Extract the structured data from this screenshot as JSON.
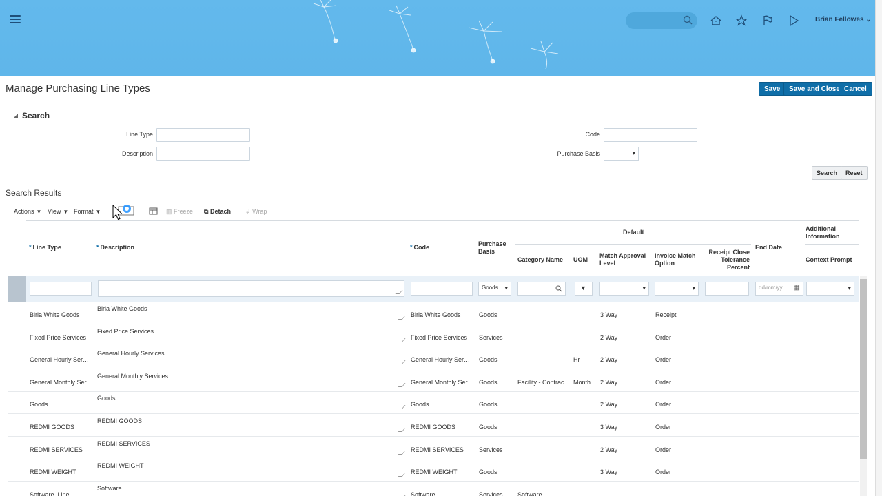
{
  "header": {
    "user_name": "Brian Fellowes",
    "icons": [
      "menu-icon",
      "search-icon",
      "home-icon",
      "star-icon",
      "flag-icon",
      "play-icon"
    ]
  },
  "page": {
    "title": "Manage Purchasing Line Types",
    "buttons": {
      "save": "Save",
      "save_close": "Save and Close",
      "cancel": "Cancel"
    }
  },
  "search": {
    "heading": "Search",
    "line_type_label": "Line Type",
    "description_label": "Description",
    "code_label": "Code",
    "purchase_basis_label": "Purchase Basis",
    "search_button": "Search",
    "reset_button": "Reset"
  },
  "results": {
    "heading": "Search Results",
    "toolbar": {
      "actions": "Actions",
      "view": "View",
      "format": "Format",
      "freeze": "Freeze",
      "detach": "Detach",
      "wrap": "Wrap"
    },
    "columns": {
      "line_type": "Line Type",
      "description": "Description",
      "code": "Code",
      "purchase_basis": "Purchase Basis",
      "default_group": "Default",
      "category_name": "Category Name",
      "uom": "UOM",
      "match_approval": "Match Approval Level",
      "invoice_match": "Invoice Match Option",
      "receipt_close": "Receipt Close Tolerance Percent",
      "end_date": "End Date",
      "additional_info": "Additional Information",
      "context_prompt": "Context Prompt"
    },
    "filters": {
      "purchase_basis": "Goods",
      "end_date_placeholder": "dd/mm/yy"
    },
    "rows": [
      {
        "line_type": "Birla White Goods",
        "description": "Birla White Goods",
        "code": "Birla White Goods",
        "basis": "Goods",
        "category": "",
        "uom": "",
        "match": "3 Way",
        "invoice": "Receipt"
      },
      {
        "line_type": "Fixed Price Services",
        "description": "Fixed Price Services",
        "code": "Fixed Price Services",
        "basis": "Services",
        "category": "",
        "uom": "",
        "match": "2 Way",
        "invoice": "Order"
      },
      {
        "line_type": "General Hourly Servi...",
        "description": "General Hourly Services",
        "code": "General Hourly Servi...",
        "basis": "Goods",
        "category": "",
        "uom": "Hr",
        "match": "2 Way",
        "invoice": "Order"
      },
      {
        "line_type": "General Monthly Ser...",
        "description": "General Monthly Services",
        "code": "General Monthly Ser...",
        "basis": "Goods",
        "category": "Facility - Contractor",
        "uom": "Month",
        "match": "2 Way",
        "invoice": "Order"
      },
      {
        "line_type": "Goods",
        "description": "Goods",
        "code": "Goods",
        "basis": "Goods",
        "category": "",
        "uom": "",
        "match": "2 Way",
        "invoice": "Order"
      },
      {
        "line_type": "REDMI GOODS",
        "description": "REDMI GOODS",
        "code": "REDMI GOODS",
        "basis": "Goods",
        "category": "",
        "uom": "",
        "match": "3 Way",
        "invoice": "Order"
      },
      {
        "line_type": "REDMI SERVICES",
        "description": "REDMI SERVICES",
        "code": "REDMI SERVICES",
        "basis": "Services",
        "category": "",
        "uom": "",
        "match": "2 Way",
        "invoice": "Order"
      },
      {
        "line_type": "REDMI WEIGHT",
        "description": "REDMI WEIGHT",
        "code": "REDMI WEIGHT",
        "basis": "Goods",
        "category": "",
        "uom": "",
        "match": "3 Way",
        "invoice": "Order"
      },
      {
        "line_type": "Software_Line",
        "description": "Software",
        "code": "Software",
        "basis": "Services",
        "category": "Software",
        "uom": "",
        "match": "",
        "invoice": ""
      }
    ]
  }
}
